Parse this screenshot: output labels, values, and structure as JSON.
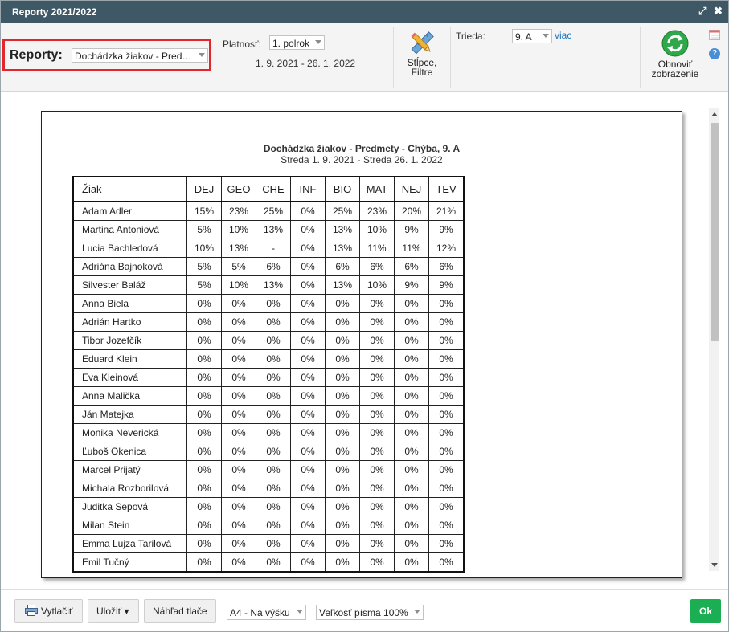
{
  "window": {
    "title": "Reporty 2021/2022",
    "maximize_glyph": "⤢",
    "close_glyph": "✖"
  },
  "toolbar": {
    "reports_label": "Reporty:",
    "report_select_value": "Dochádzka žiakov - Pred…",
    "validity_label": "Platnosť:",
    "validity_select_value": "1. polrok",
    "validity_range": "1. 9. 2021 - 26. 1. 2022",
    "columns_filter_label_line1": "Stĺpce,",
    "columns_filter_label_line2": "Filtre",
    "class_label": "Trieda:",
    "class_select_value": "9. A",
    "more_link": "viac",
    "refresh_label_line1": "Obnoviť",
    "refresh_label_line2": "zobrazenie",
    "help_glyph": "?"
  },
  "report": {
    "title": "Dochádzka žiakov - Predmety - Chýba, 9. A",
    "subtitle": "Streda 1. 9. 2021 - Streda 26. 1. 2022",
    "name_header": "Žiak",
    "columns": [
      "DEJ",
      "GEO",
      "CHE",
      "INF",
      "BIO",
      "MAT",
      "NEJ",
      "TEV"
    ],
    "rows": [
      {
        "name": "Adam Adler",
        "values": [
          "15%",
          "23%",
          "25%",
          "0%",
          "25%",
          "23%",
          "20%",
          "21%"
        ]
      },
      {
        "name": "Martina Antoniová",
        "values": [
          "5%",
          "10%",
          "13%",
          "0%",
          "13%",
          "10%",
          "9%",
          "9%"
        ]
      },
      {
        "name": "Lucia Bachledová",
        "values": [
          "10%",
          "13%",
          "-",
          "0%",
          "13%",
          "11%",
          "11%",
          "12%"
        ]
      },
      {
        "name": "Adriána Bajnoková",
        "values": [
          "5%",
          "5%",
          "6%",
          "0%",
          "6%",
          "6%",
          "6%",
          "6%"
        ]
      },
      {
        "name": "Silvester Baláž",
        "values": [
          "5%",
          "10%",
          "13%",
          "0%",
          "13%",
          "10%",
          "9%",
          "9%"
        ]
      },
      {
        "name": "Anna Biela",
        "values": [
          "0%",
          "0%",
          "0%",
          "0%",
          "0%",
          "0%",
          "0%",
          "0%"
        ]
      },
      {
        "name": "Adrián Hartko",
        "values": [
          "0%",
          "0%",
          "0%",
          "0%",
          "0%",
          "0%",
          "0%",
          "0%"
        ]
      },
      {
        "name": "Tibor Jozefčík",
        "values": [
          "0%",
          "0%",
          "0%",
          "0%",
          "0%",
          "0%",
          "0%",
          "0%"
        ]
      },
      {
        "name": "Eduard Klein",
        "values": [
          "0%",
          "0%",
          "0%",
          "0%",
          "0%",
          "0%",
          "0%",
          "0%"
        ]
      },
      {
        "name": "Eva Kleinová",
        "values": [
          "0%",
          "0%",
          "0%",
          "0%",
          "0%",
          "0%",
          "0%",
          "0%"
        ]
      },
      {
        "name": "Anna Malička",
        "values": [
          "0%",
          "0%",
          "0%",
          "0%",
          "0%",
          "0%",
          "0%",
          "0%"
        ]
      },
      {
        "name": "Ján Matejka",
        "values": [
          "0%",
          "0%",
          "0%",
          "0%",
          "0%",
          "0%",
          "0%",
          "0%"
        ]
      },
      {
        "name": "Monika Neverická",
        "values": [
          "0%",
          "0%",
          "0%",
          "0%",
          "0%",
          "0%",
          "0%",
          "0%"
        ]
      },
      {
        "name": "Ľuboš Okenica",
        "values": [
          "0%",
          "0%",
          "0%",
          "0%",
          "0%",
          "0%",
          "0%",
          "0%"
        ]
      },
      {
        "name": "Marcel Prijatý",
        "values": [
          "0%",
          "0%",
          "0%",
          "0%",
          "0%",
          "0%",
          "0%",
          "0%"
        ]
      },
      {
        "name": "Michala Rozborilová",
        "values": [
          "0%",
          "0%",
          "0%",
          "0%",
          "0%",
          "0%",
          "0%",
          "0%"
        ]
      },
      {
        "name": "Juditka Sepová",
        "values": [
          "0%",
          "0%",
          "0%",
          "0%",
          "0%",
          "0%",
          "0%",
          "0%"
        ]
      },
      {
        "name": "Milan Stein",
        "values": [
          "0%",
          "0%",
          "0%",
          "0%",
          "0%",
          "0%",
          "0%",
          "0%"
        ]
      },
      {
        "name": "Emma Lujza Tarilová",
        "values": [
          "0%",
          "0%",
          "0%",
          "0%",
          "0%",
          "0%",
          "0%",
          "0%"
        ]
      },
      {
        "name": "Emil Tučný",
        "values": [
          "0%",
          "0%",
          "0%",
          "0%",
          "0%",
          "0%",
          "0%",
          "0%"
        ]
      }
    ]
  },
  "footer": {
    "print_label": "Vytlačiť",
    "save_label": "Uložiť ▾",
    "preview_label": "Náhľad tlače",
    "paper_select_value": "A4 - Na výšku",
    "font_size_select_value": "Veľkosť písma 100%",
    "ok_label": "Ok"
  },
  "colors": {
    "titlebar": "#3f5866",
    "highlight_border": "#e3262d",
    "ok_button": "#1bae52",
    "link": "#1f72b8"
  },
  "icons": [
    "maximize-icon",
    "close-icon",
    "pencil-ruler-icon",
    "refresh-icon",
    "calendar-icon",
    "help-icon",
    "printer-icon"
  ]
}
